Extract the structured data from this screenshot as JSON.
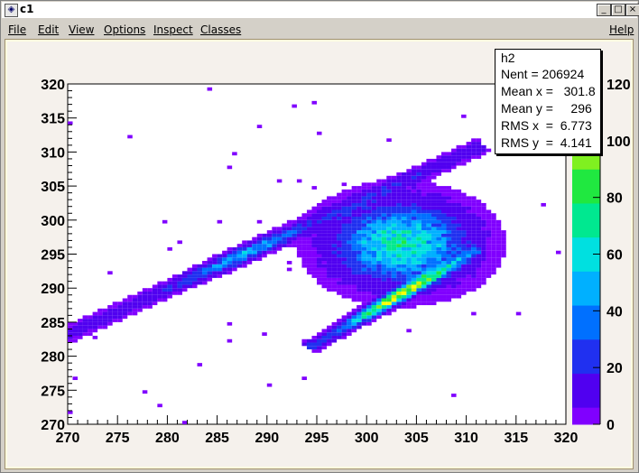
{
  "window": {
    "title": "c1"
  },
  "menu": {
    "items": [
      "File",
      "Edit",
      "View",
      "Options",
      "Inspect",
      "Classes"
    ],
    "help": "Help"
  },
  "window_buttons": {
    "minimize": "_",
    "maximize": "□",
    "close": "×"
  },
  "stats": {
    "name": "h2",
    "lines": [
      "Nent = 206924",
      "Mean x =   301.8",
      "Mean y =     296",
      "RMS x  =  6.773",
      "RMS y  =  4.141"
    ]
  },
  "colors": {
    "canvas_bg": "#f5f1ec",
    "frame_bg": "#ffffff"
  },
  "chart_data": {
    "type": "heatmap",
    "title": "",
    "xlabel": "",
    "ylabel": "",
    "xlim": [
      270,
      320
    ],
    "ylim": [
      270,
      320
    ],
    "x_ticks": [
      "270",
      "275",
      "280",
      "285",
      "290",
      "295",
      "300",
      "305",
      "310",
      "315",
      "320"
    ],
    "y_ticks": [
      "270",
      "275",
      "280",
      "285",
      "290",
      "295",
      "300",
      "305",
      "310",
      "315",
      "320"
    ],
    "z_ticks": [
      "0",
      "20",
      "40",
      "60",
      "80",
      "100",
      "120"
    ],
    "zlim": [
      0,
      120
    ],
    "palette": [
      "#8000ff",
      "#5000f0",
      "#2030f0",
      "#0070ff",
      "#00b0ff",
      "#00e0e0",
      "#00e890",
      "#20e840",
      "#80f020",
      "#d0f000",
      "#ffff00"
    ],
    "components": [
      {
        "label": "diagonal band 1",
        "x0": 270.5,
        "y0": 283.5,
        "x1": 311,
        "y1": 310.5,
        "width": 0.6,
        "peak_x": 285.5,
        "peak_y": 298.5,
        "peak": 80
      },
      {
        "label": "central blob",
        "center_x": 303.5,
        "center_y": 296.5,
        "sigma_x": 4.5,
        "sigma_y": 4.0,
        "peak": 70
      },
      {
        "label": "diagonal band 2",
        "x0": 294.5,
        "y0": 281.5,
        "x1": 311,
        "y1": 295.5,
        "width": 0.5,
        "peak_x": 302.5,
        "peak_y": 289.5,
        "peak": 110
      }
    ],
    "stats": {
      "entries": 206924,
      "mean_x": 301.8,
      "mean_y": 296,
      "rms_x": 6.773,
      "rms_y": 4.141
    }
  }
}
